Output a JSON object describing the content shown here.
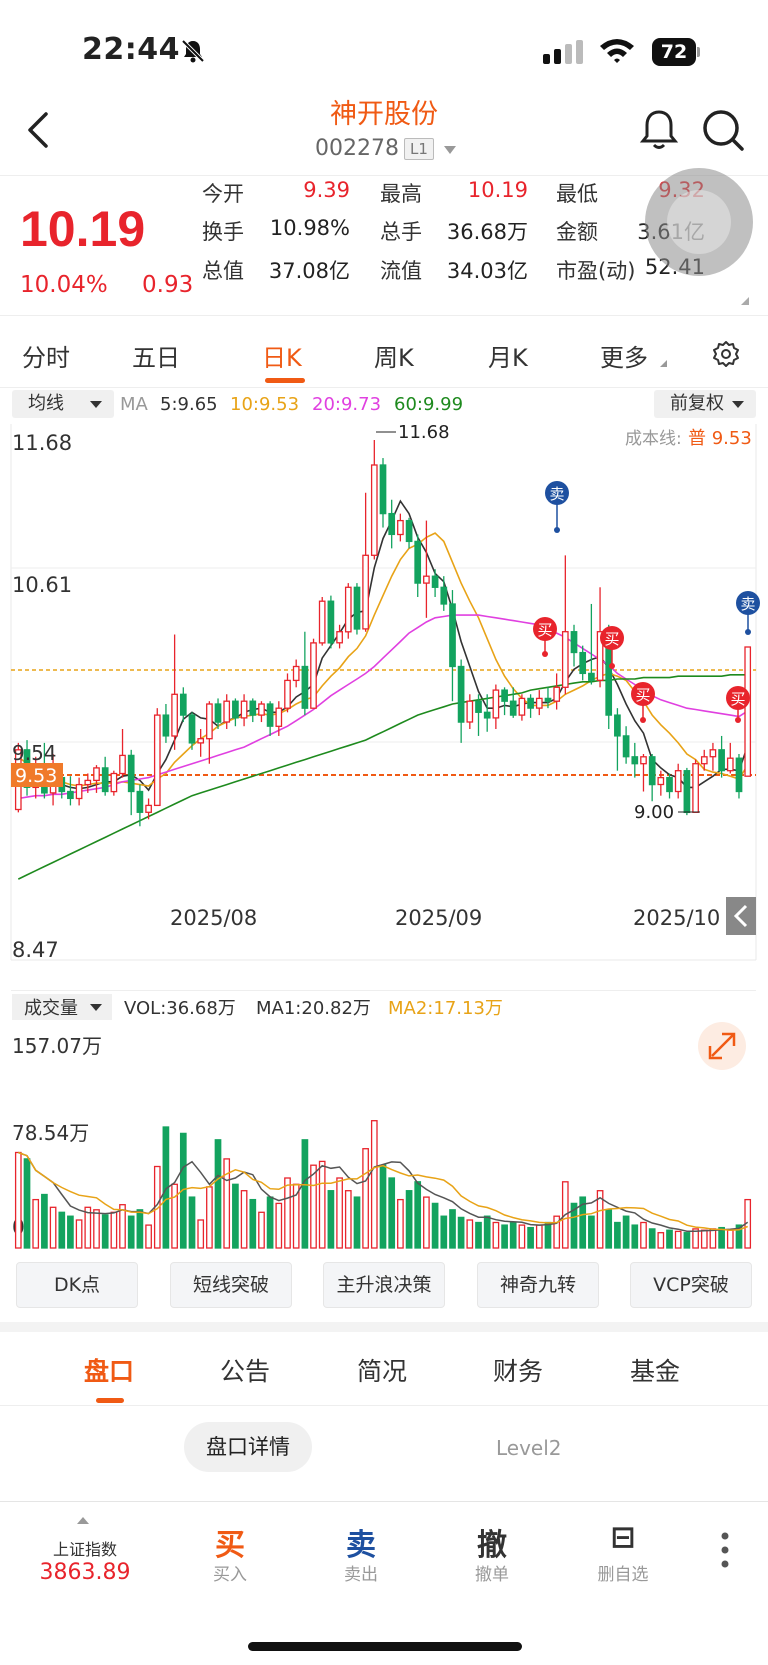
{
  "status": {
    "time": "22:44",
    "battery": "72"
  },
  "header": {
    "name": "神开股份",
    "code": "002278",
    "badge": "L1"
  },
  "quote": {
    "price": "10.19",
    "pct": "10.04%",
    "change": "0.93",
    "cells": [
      {
        "label": "今开",
        "value": "9.39",
        "red": true
      },
      {
        "label": "最高",
        "value": "10.19",
        "red": true
      },
      {
        "label": "最低",
        "value": "9.32",
        "red": true
      },
      {
        "label": "换手",
        "value": "10.98%",
        "red": false
      },
      {
        "label": "总手",
        "value": "36.68万",
        "red": false
      },
      {
        "label": "金额",
        "value": "3.61亿",
        "red": false
      },
      {
        "label": "总值",
        "value": "37.08亿",
        "red": false
      },
      {
        "label": "流值",
        "value": "34.03亿",
        "red": false
      },
      {
        "label": "市盈(动)",
        "value": "52.41",
        "red": false
      }
    ]
  },
  "period_tabs": [
    "分时",
    "五日",
    "日K",
    "周K",
    "月K",
    "更多"
  ],
  "active_period": "日K",
  "ma_legend": {
    "selector": "均线",
    "ma_label": "MA",
    "items": [
      {
        "text": "5:9.65",
        "color": "#333333"
      },
      {
        "text": "10:9.53",
        "color": "#e8a317"
      },
      {
        "text": "20:9.73",
        "color": "#e040e0"
      },
      {
        "text": "60:9.99",
        "color": "#1e8a1e"
      }
    ],
    "adjust": "前复权"
  },
  "chart_labels": {
    "y_top": "11.68",
    "y_mid": "10.61",
    "y_low": "8.47",
    "y_hidden": "9.54",
    "cost_prefix": "成本线:",
    "cost_value": "普 9.53",
    "price_tag": "9.53",
    "high_mark": "11.68",
    "low_mark": "9.00",
    "dates": [
      "2025/08",
      "2025/09",
      "2025/10"
    ],
    "buy": "买",
    "sell": "卖"
  },
  "volume": {
    "selector": "成交量",
    "vol": "VOL:36.68万",
    "ma1": "MA1:20.82万",
    "ma2": "MA2:17.13万",
    "y_top": "157.07万",
    "y_mid": "78.54万",
    "y_zero": "0"
  },
  "indicator_buttons": [
    "DK点",
    "短线突破",
    "主升浪决策",
    "神奇九转",
    "VCP突破"
  ],
  "bottom_tabs": [
    "盘口",
    "公告",
    "简况",
    "财务",
    "基金"
  ],
  "active_bottom_tab": "盘口",
  "sub_tabs": {
    "detail": "盘口详情",
    "level2": "Level2"
  },
  "toolbar": {
    "index_name": "上证指数",
    "index_value": "3863.89",
    "buttons": [
      {
        "big": "买",
        "small": "买入",
        "color": "#f05a14"
      },
      {
        "big": "卖",
        "small": "卖出",
        "color": "#1e50a0"
      },
      {
        "big": "撤",
        "small": "撤单",
        "color": "#333333"
      },
      {
        "big": "⊟",
        "small": "删自选",
        "color": "#333333"
      }
    ]
  },
  "colors": {
    "up": "#e8242c",
    "down": "#13a35f",
    "accent": "#f05a14",
    "sell": "#1e50a0"
  },
  "chart_data": {
    "type": "candlestick",
    "ylim": [
      8.47,
      11.68
    ],
    "x_ticks": [
      "2025/08",
      "2025/09",
      "2025/10"
    ],
    "candles": [
      [
        9.02,
        9.45,
        9.0,
        9.5
      ],
      [
        9.45,
        9.18,
        9.12,
        9.52
      ],
      [
        9.18,
        9.3,
        9.1,
        9.4
      ],
      [
        9.3,
        9.14,
        9.1,
        9.5
      ],
      [
        9.14,
        9.25,
        9.05,
        9.42
      ],
      [
        9.25,
        9.15,
        9.1,
        9.3
      ],
      [
        9.15,
        9.1,
        9.05,
        9.26
      ],
      [
        9.1,
        9.2,
        9.05,
        9.25
      ],
      [
        9.2,
        9.23,
        9.14,
        9.28
      ],
      [
        9.23,
        9.32,
        9.14,
        9.34
      ],
      [
        9.32,
        9.15,
        9.12,
        9.4
      ],
      [
        9.15,
        9.28,
        9.12,
        9.3
      ],
      [
        9.28,
        9.41,
        9.25,
        9.6
      ],
      [
        9.41,
        9.15,
        8.98,
        9.45
      ],
      [
        9.15,
        9.0,
        8.9,
        9.2
      ],
      [
        9.0,
        9.05,
        8.95,
        9.1
      ],
      [
        9.05,
        9.7,
        9.05,
        9.75
      ],
      [
        9.7,
        9.55,
        9.5,
        9.78
      ],
      [
        9.55,
        9.85,
        9.45,
        10.28
      ],
      [
        9.85,
        9.7,
        9.65,
        9.9
      ],
      [
        9.7,
        9.5,
        9.45,
        9.72
      ],
      [
        9.5,
        9.53,
        9.4,
        9.6
      ],
      [
        9.53,
        9.78,
        9.35,
        9.8
      ],
      [
        9.78,
        9.65,
        9.6,
        9.82
      ],
      [
        9.65,
        9.8,
        9.6,
        9.85
      ],
      [
        9.8,
        9.68,
        9.62,
        9.82
      ],
      [
        9.68,
        9.8,
        9.62,
        9.85
      ],
      [
        9.8,
        9.7,
        9.65,
        9.82
      ],
      [
        9.7,
        9.78,
        9.65,
        9.8
      ],
      [
        9.78,
        9.62,
        9.55,
        9.8
      ],
      [
        9.62,
        9.75,
        9.55,
        9.8
      ],
      [
        9.75,
        9.95,
        9.72,
        10.0
      ],
      [
        9.95,
        10.05,
        9.9,
        10.1
      ],
      [
        10.05,
        9.75,
        9.7,
        10.3
      ],
      [
        9.75,
        10.22,
        9.75,
        10.25
      ],
      [
        10.22,
        10.52,
        10.2,
        10.55
      ],
      [
        10.52,
        10.22,
        10.18,
        10.56
      ],
      [
        10.22,
        10.3,
        10.18,
        10.35
      ],
      [
        10.3,
        10.62,
        10.25,
        10.65
      ],
      [
        10.62,
        10.32,
        10.28,
        10.65
      ],
      [
        10.32,
        10.85,
        10.3,
        11.3
      ],
      [
        10.85,
        11.5,
        10.82,
        11.68
      ],
      [
        11.5,
        11.15,
        11.05,
        11.55
      ],
      [
        11.15,
        11.0,
        10.9,
        11.25
      ],
      [
        11.0,
        11.1,
        10.95,
        11.15
      ],
      [
        11.1,
        10.95,
        10.9,
        11.12
      ],
      [
        10.95,
        10.65,
        10.55,
        11.0
      ],
      [
        10.65,
        10.7,
        10.4,
        11.1
      ],
      [
        10.7,
        10.62,
        10.55,
        10.75
      ],
      [
        10.62,
        10.5,
        10.45,
        10.7
      ],
      [
        10.5,
        10.05,
        9.8,
        10.6
      ],
      [
        10.05,
        9.65,
        9.5,
        10.1
      ],
      [
        9.65,
        9.8,
        9.6,
        9.85
      ],
      [
        9.8,
        9.72,
        9.55,
        9.85
      ],
      [
        9.72,
        9.68,
        9.58,
        9.85
      ],
      [
        9.68,
        9.88,
        9.6,
        9.92
      ],
      [
        9.88,
        9.8,
        9.7,
        9.9
      ],
      [
        9.8,
        9.7,
        9.68,
        9.9
      ],
      [
        9.7,
        9.82,
        9.66,
        9.85
      ],
      [
        9.82,
        9.75,
        9.68,
        9.85
      ],
      [
        9.75,
        9.82,
        9.7,
        9.88
      ],
      [
        9.82,
        9.8,
        9.75,
        9.9
      ],
      [
        9.8,
        9.9,
        9.74,
        10.0
      ],
      [
        9.9,
        10.3,
        9.85,
        10.85
      ],
      [
        10.3,
        10.15,
        10.05,
        10.35
      ],
      [
        10.15,
        10.0,
        9.95,
        10.2
      ],
      [
        10.0,
        9.95,
        9.92,
        10.5
      ],
      [
        9.95,
        10.3,
        9.9,
        10.62
      ],
      [
        10.3,
        9.7,
        9.6,
        10.35
      ],
      [
        9.7,
        9.55,
        9.3,
        9.75
      ],
      [
        9.55,
        9.4,
        9.35,
        9.62
      ],
      [
        9.4,
        9.35,
        9.25,
        9.5
      ],
      [
        9.35,
        9.4,
        9.15,
        9.42
      ],
      [
        9.4,
        9.2,
        9.08,
        9.42
      ],
      [
        9.2,
        9.25,
        9.12,
        9.3
      ],
      [
        9.25,
        9.15,
        9.1,
        9.28
      ],
      [
        9.15,
        9.3,
        9.1,
        9.35
      ],
      [
        9.3,
        9.0,
        8.98,
        9.32
      ],
      [
        9.0,
        9.35,
        9.0,
        9.38
      ],
      [
        9.35,
        9.4,
        9.3,
        9.45
      ],
      [
        9.4,
        9.45,
        9.3,
        9.5
      ],
      [
        9.45,
        9.3,
        9.25,
        9.55
      ],
      [
        9.3,
        9.39,
        9.28,
        9.5
      ],
      [
        9.39,
        9.15,
        9.1,
        9.42
      ],
      [
        9.26,
        10.19,
        9.26,
        10.19
      ]
    ],
    "series": [
      {
        "name": "MA5",
        "values": [
          9.2,
          9.25,
          9.22,
          9.22,
          9.24,
          9.2,
          9.18,
          9.17,
          9.18,
          9.2,
          9.22,
          9.22,
          9.26,
          9.27,
          9.23,
          9.16,
          9.28,
          9.38,
          9.52,
          9.67,
          9.72,
          9.68,
          9.67,
          9.62,
          9.66,
          9.68,
          9.72,
          9.74,
          9.75,
          9.72,
          9.72,
          9.76,
          9.83,
          9.87,
          9.92,
          10.11,
          10.2,
          10.29,
          10.39,
          10.44,
          10.45,
          10.76,
          10.97,
          11.1,
          11.24,
          11.15,
          10.98,
          10.87,
          10.72,
          10.66,
          10.46,
          10.23,
          10.05,
          9.87,
          9.75,
          9.75,
          9.77,
          9.76,
          9.78,
          9.79,
          9.79,
          9.79,
          9.82,
          9.94,
          10.03,
          10.07,
          10.1,
          10.12,
          10.04,
          9.92,
          9.78,
          9.66,
          9.57,
          9.38,
          9.32,
          9.27,
          9.25,
          9.18,
          9.18,
          9.22,
          9.26,
          9.31,
          9.31,
          9.3,
          9.48
        ]
      },
      {
        "name": "MA10",
        "values": [
          9.4,
          9.35,
          9.3,
          9.28,
          9.25,
          9.22,
          9.2,
          9.19,
          9.2,
          9.21,
          9.21,
          9.21,
          9.22,
          9.21,
          9.2,
          9.19,
          9.24,
          9.28,
          9.36,
          9.42,
          9.48,
          9.53,
          9.57,
          9.62,
          9.65,
          9.68,
          9.69,
          9.7,
          9.71,
          9.7,
          9.71,
          9.74,
          9.78,
          9.81,
          9.83,
          9.91,
          9.98,
          10.04,
          10.12,
          10.18,
          10.27,
          10.42,
          10.56,
          10.7,
          10.82,
          10.9,
          10.93,
          10.98,
          11.01,
          10.95,
          10.8,
          10.65,
          10.52,
          10.4,
          10.25,
          10.1,
          9.98,
          9.89,
          9.82,
          9.77,
          9.77,
          9.77,
          9.8,
          9.85,
          9.88,
          9.91,
          9.95,
          9.98,
          10.0,
          9.98,
          9.95,
          9.87,
          9.8,
          9.7,
          9.63,
          9.57,
          9.5,
          9.42,
          9.38,
          9.31,
          9.29,
          9.28,
          9.26,
          9.24,
          9.34
        ]
      },
      {
        "name": "MA20",
        "values": [
          9.1,
          9.11,
          9.12,
          9.12,
          9.13,
          9.13,
          9.14,
          9.15,
          9.16,
          9.17,
          9.18,
          9.2,
          9.22,
          9.23,
          9.24,
          9.25,
          9.27,
          9.29,
          9.31,
          9.33,
          9.35,
          9.37,
          9.39,
          9.41,
          9.43,
          9.45,
          9.47,
          9.5,
          9.53,
          9.56,
          9.59,
          9.62,
          9.66,
          9.7,
          9.74,
          9.79,
          9.84,
          9.88,
          9.92,
          9.96,
          10.0,
          10.05,
          10.11,
          10.17,
          10.23,
          10.29,
          10.33,
          10.37,
          10.4,
          10.41,
          10.42,
          10.42,
          10.42,
          10.42,
          10.41,
          10.4,
          10.39,
          10.38,
          10.37,
          10.36,
          10.35,
          10.32,
          10.29,
          10.26,
          10.22,
          10.18,
          10.14,
          10.1,
          10.06,
          10.0,
          9.96,
          9.92,
          9.88,
          9.84,
          9.81,
          9.79,
          9.77,
          9.75,
          9.74,
          9.73,
          9.72,
          9.71,
          9.7,
          9.69,
          9.73
        ]
      },
      {
        "name": "MA60",
        "values": [
          8.52,
          8.55,
          8.58,
          8.61,
          8.64,
          8.67,
          8.7,
          8.73,
          8.76,
          8.79,
          8.82,
          8.85,
          8.88,
          8.91,
          8.94,
          8.97,
          9.0,
          9.03,
          9.06,
          9.09,
          9.12,
          9.14,
          9.16,
          9.18,
          9.2,
          9.22,
          9.24,
          9.26,
          9.28,
          9.3,
          9.32,
          9.34,
          9.36,
          9.38,
          9.4,
          9.42,
          9.44,
          9.46,
          9.48,
          9.5,
          9.52,
          9.55,
          9.58,
          9.61,
          9.64,
          9.67,
          9.7,
          9.72,
          9.74,
          9.76,
          9.78,
          9.79,
          9.8,
          9.81,
          9.82,
          9.83,
          9.84,
          9.85,
          9.86,
          9.88,
          9.89,
          9.9,
          9.91,
          9.92,
          9.93,
          9.94,
          9.94,
          9.95,
          9.95,
          9.96,
          9.96,
          9.96,
          9.97,
          9.97,
          9.97,
          9.97,
          9.98,
          9.98,
          9.98,
          9.98,
          9.98,
          9.98,
          9.99,
          9.99,
          9.99
        ]
      }
    ],
    "volume": [
      75,
      70,
      38,
      42,
      32,
      28,
      25,
      22,
      32,
      30,
      26,
      28,
      34,
      25,
      30,
      18,
      64,
      95,
      50,
      90,
      40,
      22,
      48,
      85,
      70,
      50,
      45,
      38,
      28,
      40,
      35,
      55,
      50,
      85,
      65,
      68,
      45,
      55,
      45,
      40,
      78,
      100,
      65,
      55,
      38,
      45,
      52,
      40,
      35,
      25,
      30,
      24,
      22,
      20,
      25,
      20,
      18,
      20,
      18,
      16,
      18,
      20,
      25,
      52,
      35,
      40,
      25,
      45,
      30,
      20,
      25,
      18,
      20,
      15,
      12,
      14,
      13,
      12,
      15,
      14,
      15,
      16,
      14,
      18,
      38
    ],
    "vol_ylim": [
      0,
      157.07
    ]
  }
}
